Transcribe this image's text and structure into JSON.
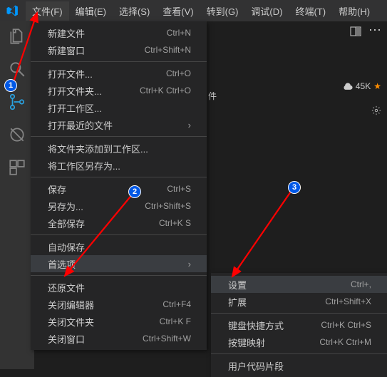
{
  "menubar": {
    "items": [
      {
        "label": "文件(F)"
      },
      {
        "label": "编辑(E)"
      },
      {
        "label": "选择(S)"
      },
      {
        "label": "查看(V)"
      },
      {
        "label": "转到(G)"
      },
      {
        "label": "调试(D)"
      },
      {
        "label": "终端(T)"
      },
      {
        "label": "帮助(H)"
      }
    ]
  },
  "file_menu": {
    "g1": [
      {
        "label": "新建文件",
        "shortcut": "Ctrl+N"
      },
      {
        "label": "新建窗口",
        "shortcut": "Ctrl+Shift+N"
      }
    ],
    "g2": [
      {
        "label": "打开文件...",
        "shortcut": "Ctrl+O"
      },
      {
        "label": "打开文件夹...",
        "shortcut": "Ctrl+K Ctrl+O"
      },
      {
        "label": "打开工作区..."
      },
      {
        "label": "打开最近的文件",
        "chevron": true
      }
    ],
    "g3": [
      {
        "label": "将文件夹添加到工作区..."
      },
      {
        "label": "将工作区另存为..."
      }
    ],
    "g4": [
      {
        "label": "保存",
        "shortcut": "Ctrl+S"
      },
      {
        "label": "另存为...",
        "shortcut": "Ctrl+Shift+S"
      },
      {
        "label": "全部保存",
        "shortcut": "Ctrl+K S"
      }
    ],
    "g5": [
      {
        "label": "自动保存"
      },
      {
        "label": "首选项",
        "chevron": true,
        "hover": true
      }
    ],
    "g6": [
      {
        "label": "还原文件"
      },
      {
        "label": "关闭编辑器",
        "shortcut": "Ctrl+F4"
      },
      {
        "label": "关闭文件夹",
        "shortcut": "Ctrl+K F"
      },
      {
        "label": "关闭窗口",
        "shortcut": "Ctrl+Shift+W"
      }
    ]
  },
  "prefs_menu": {
    "g1": [
      {
        "label": "设置",
        "shortcut": "Ctrl+,",
        "hover": true
      },
      {
        "label": "扩展",
        "shortcut": "Ctrl+Shift+X"
      }
    ],
    "g2": [
      {
        "label": "键盘快捷方式",
        "shortcut": "Ctrl+K Ctrl+S"
      },
      {
        "label": "按键映射",
        "shortcut": "Ctrl+K Ctrl+M"
      }
    ],
    "g3": [
      {
        "label": "用户代码片段"
      }
    ]
  },
  "extras": {
    "count": "45K",
    "file_suffix": "件"
  }
}
